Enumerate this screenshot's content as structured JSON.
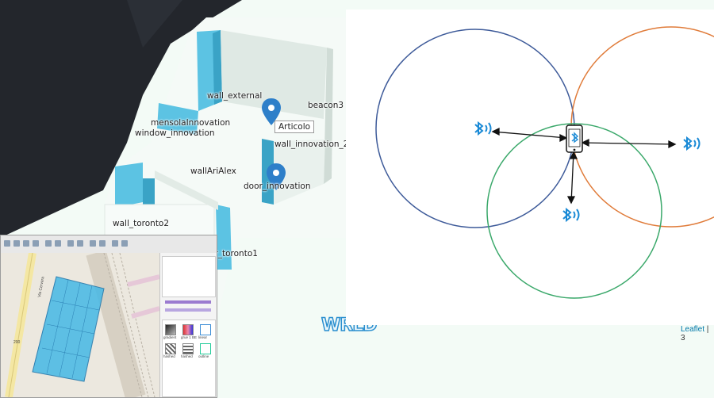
{
  "scene_labels": {
    "wall_external": "wall_external",
    "beacon3": "beacon3",
    "mensola": "mensolaInnovation",
    "window": "window_innovation",
    "wall_innovation_2": "wall_innovation_2",
    "wallarialex": "wallAriAlex",
    "door_innovation": "door_innovation",
    "wall_toronto2": "wall_toronto2",
    "door_toronto1": "or_toronto1"
  },
  "tooltip": "Articolo",
  "wrld_logo": "WRLD",
  "attribution": {
    "link": "Leaflet",
    "sep": " | 3"
  },
  "gis": {
    "road_label": "Via Cervara",
    "side_number": "200",
    "styles": [
      "gradient",
      "grue 1 BE",
      "linear",
      "hashed",
      "hashed",
      "outline"
    ]
  },
  "colors": {
    "circle_blue": "#3d5a99",
    "circle_orange": "#e07b39",
    "circle_green": "#3aa86a",
    "bluetooth": "#1a8ad6",
    "room_blue": "#5cc3e3",
    "dark_bg": "#23262c"
  }
}
